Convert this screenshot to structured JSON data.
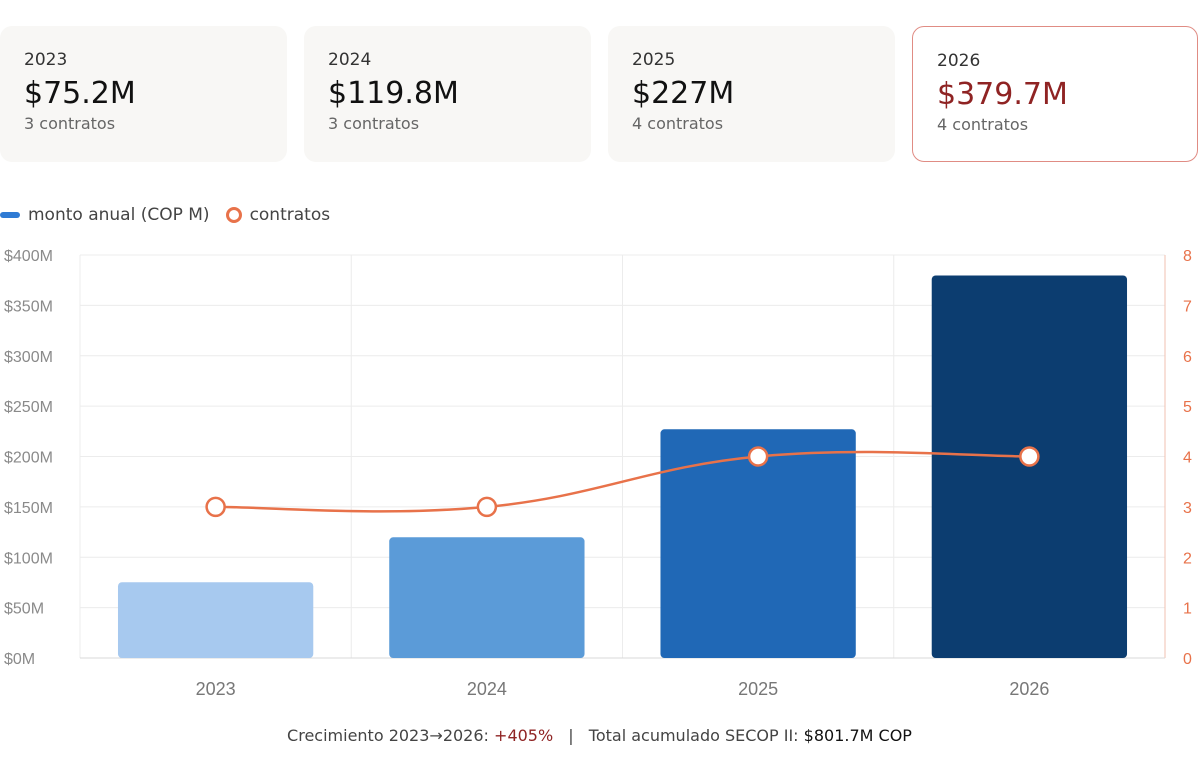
{
  "cards": [
    {
      "year": "2023",
      "amount": "$75.2M",
      "count": "3 contratos"
    },
    {
      "year": "2024",
      "amount": "$119.8M",
      "count": "3 contratos"
    },
    {
      "year": "2025",
      "amount": "$227M",
      "count": "4 contratos"
    },
    {
      "year": "2026",
      "amount": "$379.7M",
      "count": "4 contratos"
    }
  ],
  "legend": {
    "bar_label": "monto anual (COP M)",
    "line_label": "contratos"
  },
  "footer": {
    "growth_prefix": "Crecimiento 2023→2026:",
    "growth_value": "+405%",
    "separator": "|",
    "total_prefix": "Total acumulado SECOP II:",
    "total_value": "$801.7M COP"
  },
  "colors": {
    "bars": [
      "#a7c9ef",
      "#5b9bd8",
      "#2068b6",
      "#0c3d70"
    ],
    "line": "#e8724a",
    "highlight_text": "#8f2323",
    "highlight_border": "#e08c84"
  },
  "chart_data": {
    "type": "bar",
    "categories": [
      "2023",
      "2024",
      "2025",
      "2026"
    ],
    "series": [
      {
        "name": "monto anual (COP M)",
        "type": "bar",
        "axis": "left",
        "values": [
          75.2,
          119.8,
          227,
          379.7
        ]
      },
      {
        "name": "contratos",
        "type": "line",
        "axis": "right",
        "values": [
          3,
          3,
          4,
          4
        ]
      }
    ],
    "y_left": {
      "min": 0,
      "max": 400,
      "ticks": [
        0,
        50,
        100,
        150,
        200,
        250,
        300,
        350,
        400
      ],
      "tick_labels": [
        "$0M",
        "$50M",
        "$100M",
        "$150M",
        "$200M",
        "$250M",
        "$300M",
        "$350M",
        "$400M"
      ]
    },
    "y_right": {
      "min": 0,
      "max": 8,
      "ticks": [
        0,
        1,
        2,
        3,
        4,
        5,
        6,
        7,
        8
      ],
      "tick_labels": [
        "0",
        "1",
        "2",
        "3",
        "4",
        "5",
        "6",
        "7",
        "8"
      ]
    },
    "grid": true,
    "legend_position": "top-left"
  }
}
